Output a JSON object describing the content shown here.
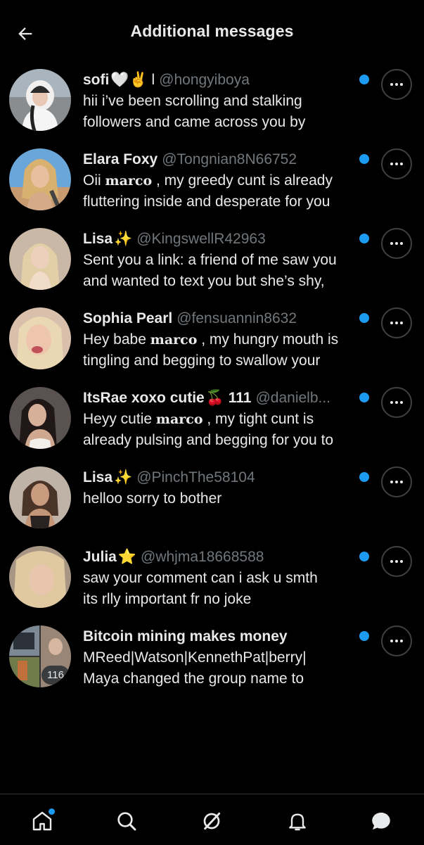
{
  "header": {
    "title": "Additional messages",
    "back_icon": "arrow-left-icon"
  },
  "colors": {
    "background": "#000000",
    "text_primary": "#e7e9ea",
    "text_secondary": "#71767b",
    "accent": "#1d9bf0",
    "border": "#2f3336"
  },
  "messages": [
    {
      "name": "sofi",
      "name_emoji": "🤍✌️ l",
      "handle": "@hongyiboya",
      "preview_line1": "hii i’ve been scrolling and stalking",
      "preview_line2": "followers and came across you by",
      "unread": true
    },
    {
      "name": "Elara Foxy",
      "name_emoji": "",
      "handle": "@Tongnian8N66752",
      "preview_pre": "Oii ",
      "preview_name": "marco",
      "preview_line1_post": " , my greedy cunt is already",
      "preview_line2": "fluttering inside and desperate for you",
      "unread": true
    },
    {
      "name": "Lisa",
      "name_emoji": "✨",
      "handle": "@KingswellR42963",
      "preview_line1": "Sent you a link: a friend of me saw you",
      "preview_line2": "and wanted to text you but she’s shy,",
      "unread": true
    },
    {
      "name": "Sophia Pearl",
      "name_emoji": "",
      "handle": "@fensuannin8632",
      "preview_pre": "Hey babe ",
      "preview_name": "marco",
      "preview_line1_post": " , my hungry mouth is",
      "preview_line2": "tingling and begging to swallow your",
      "unread": true
    },
    {
      "name": "ItsRae xoxo cutie",
      "name_emoji": "🍒",
      "name_suffix": "111",
      "handle": "@danielb...",
      "preview_pre": "Heyy cutie ",
      "preview_name": "marco",
      "preview_line1_post": " , my tight cunt is",
      "preview_line2": "already pulsing and begging for you to",
      "unread": true
    },
    {
      "name": "Lisa",
      "name_emoji": "✨",
      "handle": "@PinchThe58104",
      "preview_line1": "helloo sorry to bother",
      "preview_line2": "",
      "unread": true
    },
    {
      "name": "Julia",
      "name_emoji": "⭐",
      "handle": "@whjma18668588",
      "preview_line1": "saw your comment can i ask u smth",
      "preview_line2": "its rlly important fr no joke",
      "unread": true
    },
    {
      "name": "Bitcoin mining makes money",
      "name_emoji": "",
      "handle": "",
      "group_count": "116",
      "preview_line1": "MReed|Watson|KennethPat|berry|",
      "preview_line2": "Maya changed the group name to",
      "unread": true
    }
  ],
  "nav": {
    "home_icon": "home-icon",
    "search_icon": "search-icon",
    "grok_icon": "grok-icon",
    "notifications_icon": "bell-icon",
    "messages_icon": "messages-icon"
  }
}
